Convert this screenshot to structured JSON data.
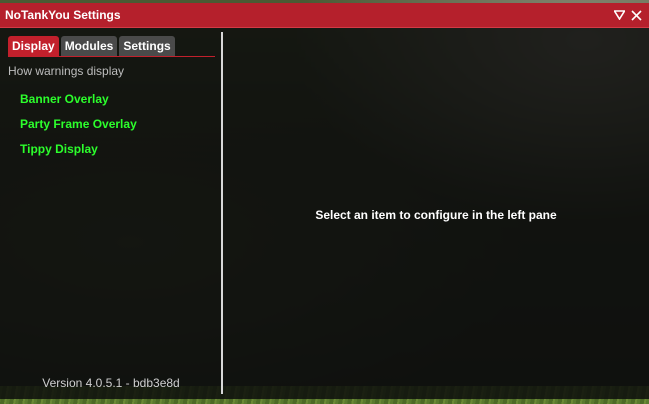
{
  "window": {
    "title": "NoTankYou Settings"
  },
  "titlebar_buttons": {
    "collapse_icon": "triangle-down-icon",
    "close_icon": "close-icon"
  },
  "tabs": [
    {
      "label": "Display",
      "active": true
    },
    {
      "label": "Modules",
      "active": false
    },
    {
      "label": "Settings",
      "active": false
    }
  ],
  "left_pane": {
    "section_label": "How warnings display",
    "items": [
      {
        "label": "Banner Overlay"
      },
      {
        "label": "Party Frame Overlay"
      },
      {
        "label": "Tippy Display"
      }
    ],
    "version": "Version 4.0.5.1 - bdb3e8d"
  },
  "right_pane": {
    "placeholder": "Select an item to configure in the left pane"
  },
  "colors": {
    "accent": "#c2202c",
    "item_text": "#2cff2c"
  }
}
